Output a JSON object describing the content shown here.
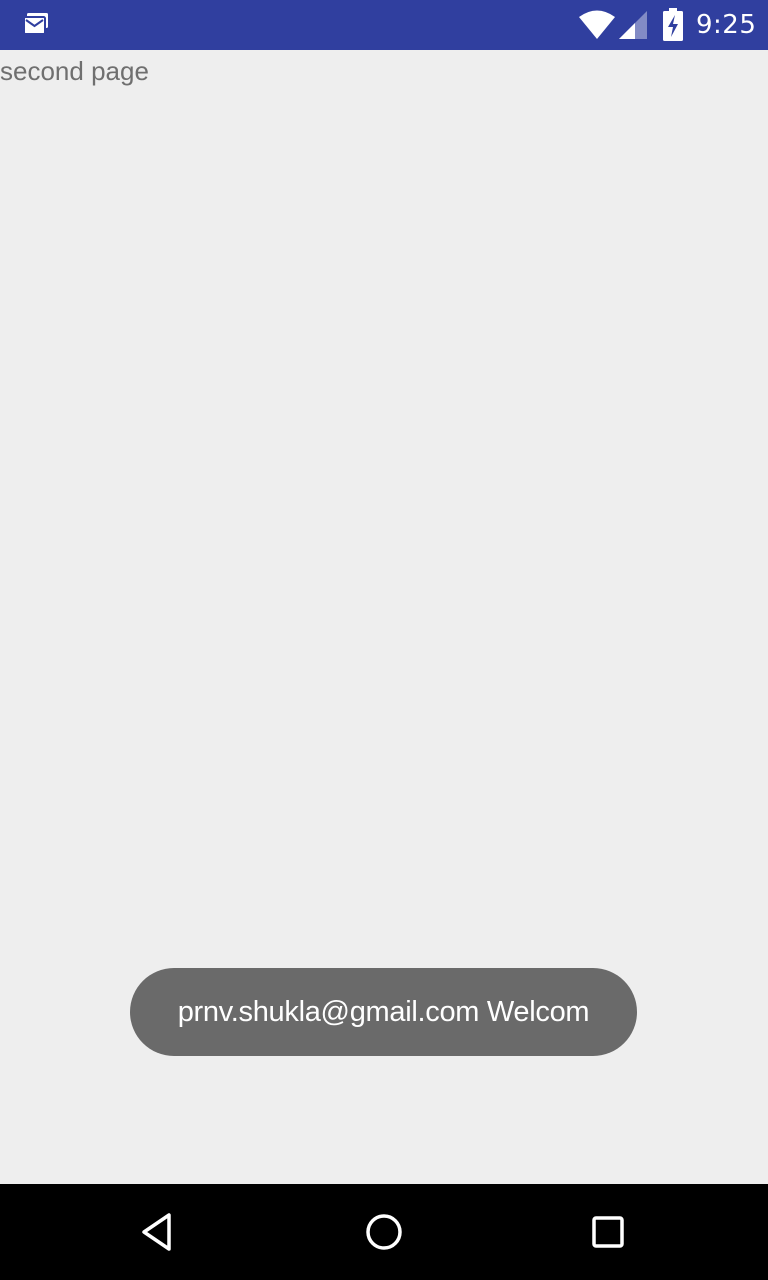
{
  "status_bar": {
    "time": "9:25",
    "color": "#303f9f",
    "icons": [
      "notification-icon",
      "wifi-icon",
      "cell-signal-icon",
      "battery-charging-icon"
    ]
  },
  "page": {
    "label": "second page",
    "background": "#eeeeee"
  },
  "toast": {
    "message": "prnv.shukla@gmail.com Welcom",
    "background": "#6a6a6a"
  },
  "nav_bar": {
    "buttons": [
      "back-icon",
      "home-icon",
      "recents-icon"
    ]
  }
}
